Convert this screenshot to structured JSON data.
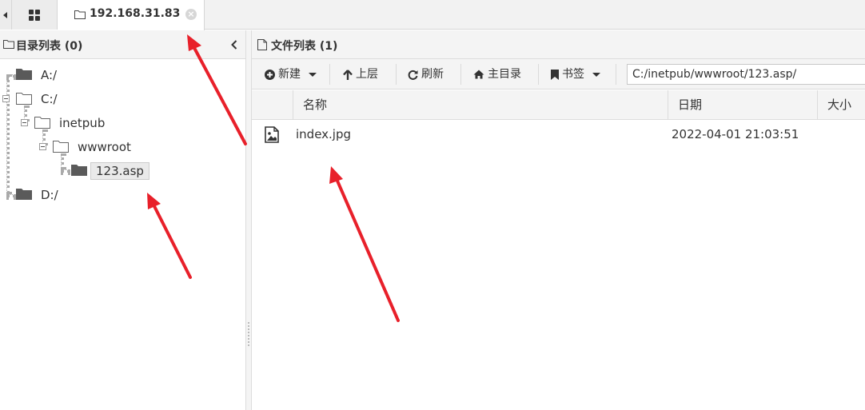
{
  "tabs": {
    "active_label": "192.168.31.83",
    "close_glyph": "×"
  },
  "left_panel": {
    "title": "目录列表 (0)",
    "tree": [
      {
        "label": "A:/"
      },
      {
        "label": "C:/"
      },
      {
        "label": "inetpub"
      },
      {
        "label": "wwwroot"
      },
      {
        "label": "123.asp"
      },
      {
        "label": "D:/"
      }
    ]
  },
  "right_panel": {
    "title": "文件列表 (1)",
    "toolbar": {
      "new_label": "新建",
      "up_label": "上层",
      "refresh_label": "刷新",
      "home_label": "主目录",
      "bookmark_label": "书签",
      "path_value": "C:/inetpub/wwwroot/123.asp/"
    },
    "columns": [
      "名称",
      "日期",
      "大小"
    ],
    "rows": [
      {
        "name": "index.jpg",
        "date": "2022-04-01 21:03:51",
        "size": ""
      }
    ]
  },
  "colors": {
    "annotation_arrow": "#e8202a",
    "folder": "#5a5a5a"
  },
  "icons": [
    "grid-icon",
    "folder-icon",
    "close-icon",
    "chevron-left-icon",
    "plus-circle-icon",
    "arrow-up-icon",
    "refresh-icon",
    "home-icon",
    "bookmark-icon",
    "image-file-icon"
  ]
}
